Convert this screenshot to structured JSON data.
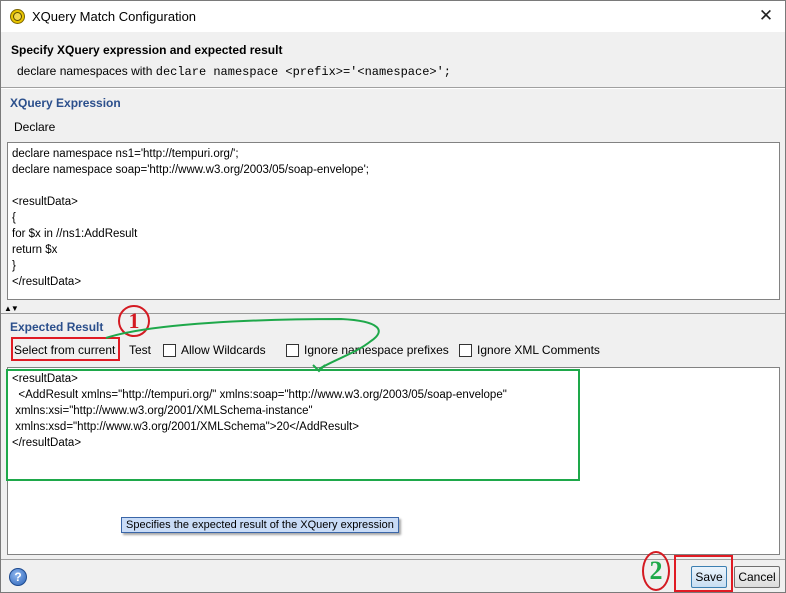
{
  "window": {
    "title": "XQuery Match Configuration",
    "icon": "xquery-gear-icon",
    "close_icon": "close-icon"
  },
  "header": {
    "title": "Specify XQuery expression and expected result",
    "desc_prefix": "declare namespaces with ",
    "desc_code": "declare namespace <prefix>='<namespace>';"
  },
  "xquery": {
    "section_label": "XQuery Expression",
    "declare_label": "Declare",
    "expression": "declare namespace ns1='http://tempuri.org/';\ndeclare namespace soap='http://www.w3.org/2003/05/soap-envelope';\n\n<resultData>\n{\nfor $x in //ns1:AddResult\nreturn $x\n}\n</resultData>"
  },
  "splitter": {
    "icon": "expand-collapse-arrows-icon",
    "glyph": "▲▼"
  },
  "expected": {
    "section_label": "Expected Result",
    "select_from_current": "Select from current",
    "test": "Test",
    "allow_wildcards": "Allow Wildcards",
    "allow_wildcards_checked": false,
    "ignore_ns_prefixes": "Ignore namespace prefixes",
    "ignore_ns_prefixes_checked": false,
    "ignore_xml_comments": "Ignore XML Comments",
    "ignore_xml_comments_checked": false,
    "result": "<resultData>\n  <AddResult xmlns=\"http://tempuri.org/\" xmlns:soap=\"http://www.w3.org/2003/05/soap-envelope\"\n xmlns:xsi=\"http://www.w3.org/2001/XMLSchema-instance\"\n xmlns:xsd=\"http://www.w3.org/2001/XMLSchema\">20</AddResult>\n</resultData>",
    "tooltip": "Specifies the expected result of the XQuery expression"
  },
  "footer": {
    "help_icon": "help-icon",
    "help_glyph": "?",
    "save": "Save",
    "cancel": "Cancel"
  },
  "annotations": {
    "step1": "1",
    "step2": "2",
    "red": "#e01b24",
    "green": "#1ea84a"
  }
}
